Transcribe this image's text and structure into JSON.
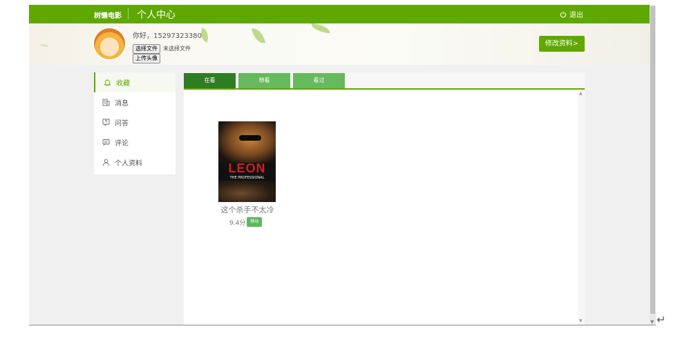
{
  "header": {
    "brand": "树懒电影",
    "title": "个人中心",
    "logout_label": "退出"
  },
  "profile": {
    "greeting": "你好，15297323380",
    "choose_file_label": "选择文件",
    "no_file_label": "未选择文件",
    "upload_avatar_label": "上传头像",
    "edit_profile_label": "修改资料>"
  },
  "sidebar": {
    "items": [
      {
        "label": "收藏",
        "icon": "bell-icon",
        "active": true
      },
      {
        "label": "消息",
        "icon": "building-icon"
      },
      {
        "label": "问答",
        "icon": "question-icon"
      },
      {
        "label": "评论",
        "icon": "comment-icon"
      },
      {
        "label": "个人资料",
        "icon": "user-icon"
      }
    ]
  },
  "tabs": [
    {
      "label": "在看",
      "active": true
    },
    {
      "label": "想看"
    },
    {
      "label": "看过"
    }
  ],
  "movies": [
    {
      "title": "这个杀手不太冷",
      "score": "9.4分",
      "move_label": "移动",
      "poster_title": "LEON",
      "poster_subtitle": "THE PROFESSIONAL"
    }
  ],
  "colors": {
    "brand_green": "#5fa800",
    "tab_active": "#2f7d22",
    "tab_inactive": "#66b95c"
  }
}
